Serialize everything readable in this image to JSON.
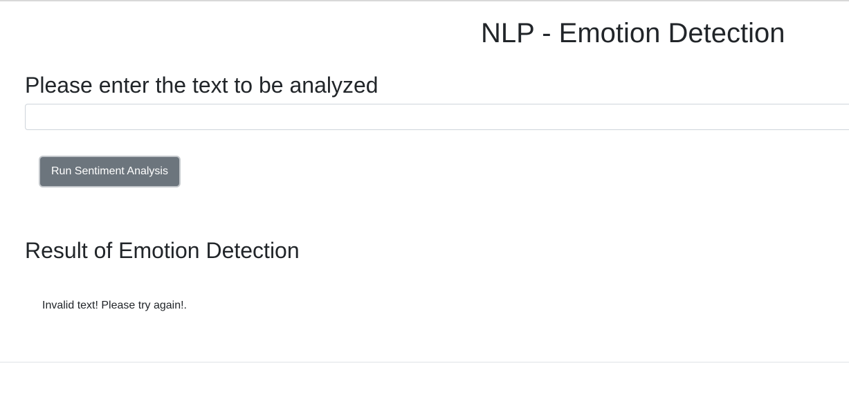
{
  "header": {
    "title": "NLP - Emotion Detection"
  },
  "form": {
    "prompt": "Please enter the text to be analyzed",
    "input_value": "",
    "input_placeholder": "",
    "run_button_label": "Run Sentiment Analysis"
  },
  "result": {
    "heading": "Result of Emotion Detection",
    "message": "Invalid text! Please try again!."
  },
  "colors": {
    "button_background": "#6c757d",
    "button_text": "#ffffff",
    "text": "#212529",
    "input_border": "#ced4da"
  }
}
